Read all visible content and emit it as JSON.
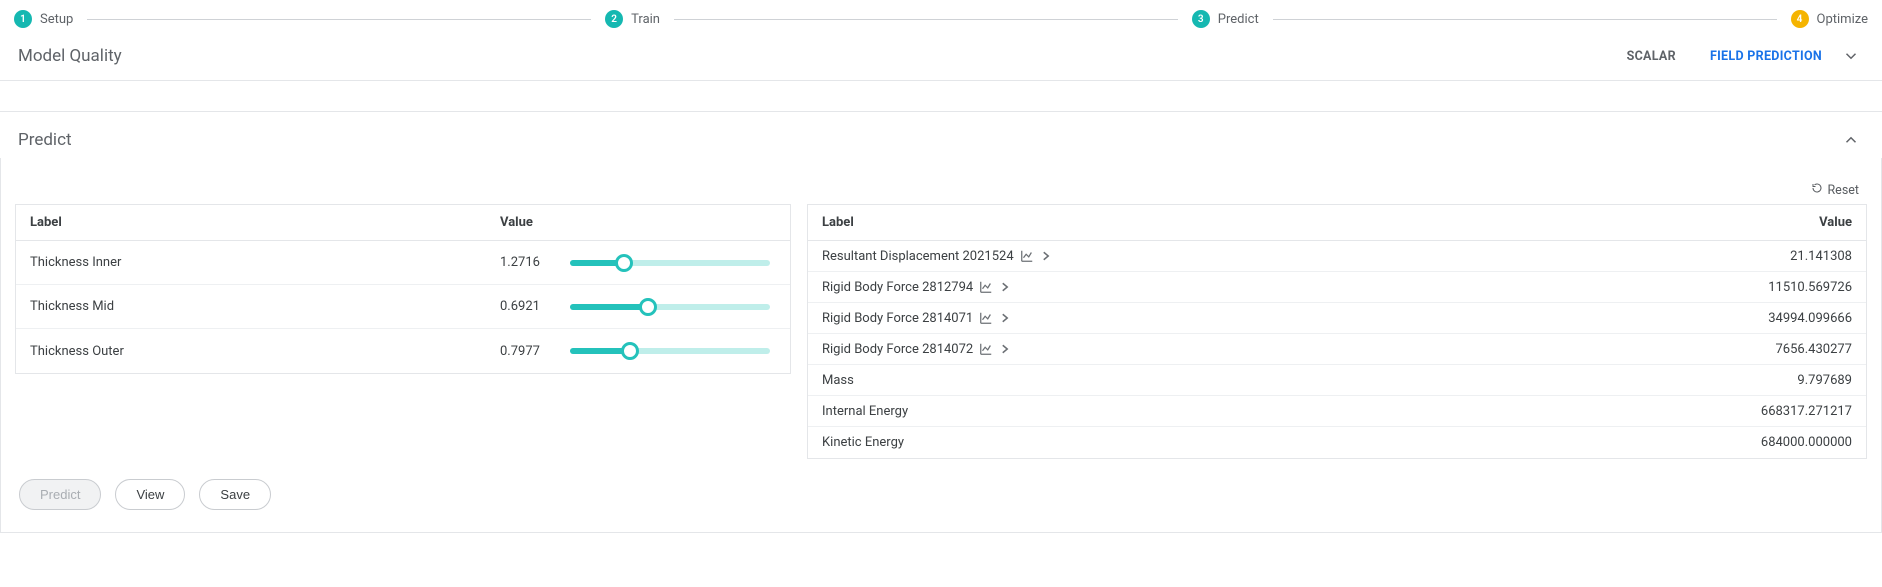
{
  "stepper": {
    "steps": [
      {
        "num": "1",
        "label": "Setup",
        "color": "teal"
      },
      {
        "num": "2",
        "label": "Train",
        "color": "teal"
      },
      {
        "num": "3",
        "label": "Predict",
        "color": "teal"
      },
      {
        "num": "4",
        "label": "Optimize",
        "color": "amber"
      }
    ]
  },
  "model_quality": {
    "title": "Model Quality",
    "tabs": {
      "scalar": "SCALAR",
      "field_prediction": "FIELD PREDICTION",
      "active": "field_prediction"
    }
  },
  "predict": {
    "title": "Predict",
    "reset_label": "Reset",
    "inputs_header": {
      "label": "Label",
      "value": "Value"
    },
    "inputs": [
      {
        "label": "Thickness Inner",
        "value": "1.2716",
        "pct": 27
      },
      {
        "label": "Thickness Mid",
        "value": "0.6921",
        "pct": 39
      },
      {
        "label": "Thickness Outer",
        "value": "0.7977",
        "pct": 30
      }
    ],
    "outputs_header": {
      "label": "Label",
      "value": "Value"
    },
    "outputs": [
      {
        "label": "Resultant Displacement 2021524",
        "value": "21.141308",
        "expandable": true
      },
      {
        "label": "Rigid Body Force 2812794",
        "value": "11510.569726",
        "expandable": true
      },
      {
        "label": "Rigid Body Force 2814071",
        "value": "34994.099666",
        "expandable": true
      },
      {
        "label": "Rigid Body Force 2814072",
        "value": "7656.430277",
        "expandable": true
      },
      {
        "label": "Mass",
        "value": "9.797689",
        "expandable": false
      },
      {
        "label": "Internal Energy",
        "value": "668317.271217",
        "expandable": false
      },
      {
        "label": "Kinetic Energy",
        "value": "684000.000000",
        "expandable": false
      }
    ],
    "buttons": {
      "predict": "Predict",
      "view": "View",
      "save": "Save"
    }
  }
}
